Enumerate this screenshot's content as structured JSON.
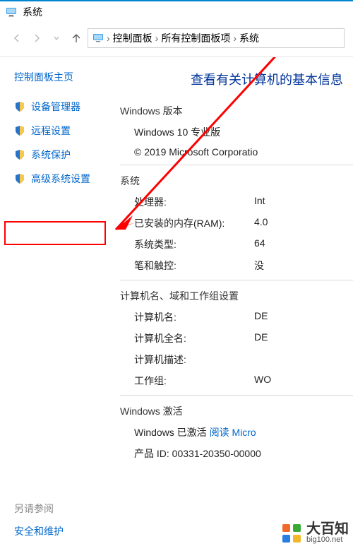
{
  "titlebar": {
    "title": "系统"
  },
  "breadcrumb": {
    "items": [
      "控制面板",
      "所有控制面板项",
      "系统"
    ]
  },
  "sidebar": {
    "title": "控制面板主页",
    "items": [
      {
        "label": "设备管理器"
      },
      {
        "label": "远程设置"
      },
      {
        "label": "系统保护"
      },
      {
        "label": "高级系统设置"
      }
    ],
    "see_also_label": "另请参阅",
    "see_also_link": "安全和维护"
  },
  "main": {
    "heading": "查看有关计算机的基本信息",
    "edition_section": "Windows 版本",
    "edition": "Windows 10 专业版",
    "copyright": "© 2019 Microsoft Corporatio",
    "system_section": "系统",
    "rows": {
      "cpu_k": "处理器:",
      "cpu_v": "Int",
      "ram_k": "已安装的内存(RAM):",
      "ram_v": "4.0",
      "type_k": "系统类型:",
      "type_v": "64",
      "pen_k": "笔和触控:",
      "pen_v": "没"
    },
    "naming_section": "计算机名、域和工作组设置",
    "name_rows": {
      "cn_k": "计算机名:",
      "cn_v": "DE",
      "fn_k": "计算机全名:",
      "fn_v": "DE",
      "desc_k": "计算机描述:",
      "desc_v": "",
      "wg_k": "工作组:",
      "wg_v": "WO"
    },
    "activation_section": "Windows 激活",
    "activation_text": "Windows 已激活  ",
    "activation_link": "阅读 Micro",
    "product_id_label": "产品 ID: ",
    "product_id": "00331-20350-00000"
  },
  "watermark": {
    "main": "大百知",
    "sub": "big100.net"
  }
}
